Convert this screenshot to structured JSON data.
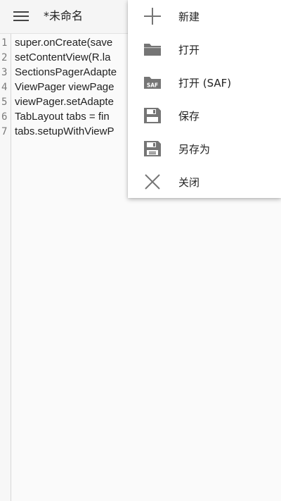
{
  "toolbar": {
    "menu_icon": "hamburger-menu-icon",
    "title": "*未命名"
  },
  "editor": {
    "line_numbers": [
      "1",
      "2",
      "3",
      "4",
      "5",
      "6",
      "7"
    ],
    "lines": [
      "super.onCreate(save",
      "setContentView(R.la",
      "SectionsPagerAdapte",
      "ViewPager viewPage",
      "viewPager.setAdapte",
      "TabLayout tabs = fin",
      "tabs.setupWithViewP"
    ]
  },
  "menu": {
    "items": [
      {
        "label": "新建",
        "icon": "plus-icon"
      },
      {
        "label": "打开",
        "icon": "folder-icon"
      },
      {
        "label": "打开 (SAF)",
        "icon": "saf-folder-icon",
        "icon_text": "SAF"
      },
      {
        "label": "保存",
        "icon": "save-icon"
      },
      {
        "label": "另存为",
        "icon": "save-as-icon"
      },
      {
        "label": "关闭",
        "icon": "close-icon"
      }
    ]
  },
  "colors": {
    "icon": "#757575",
    "toolbar_bg": "#f5f5f5",
    "menu_bg": "#ffffff",
    "text": "#222222"
  }
}
